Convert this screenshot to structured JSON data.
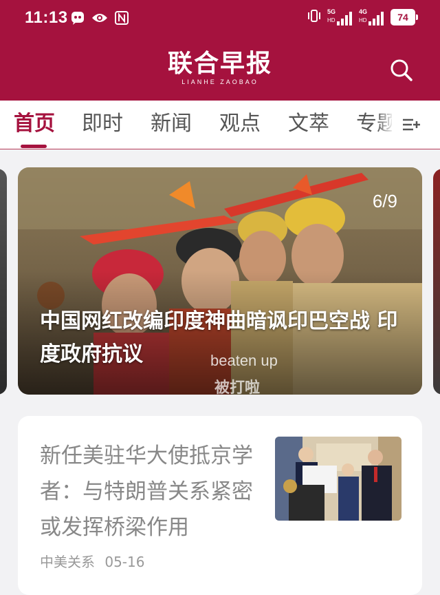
{
  "status_bar": {
    "time": "11:13",
    "network_1": "5G",
    "network_2": "4G",
    "network_sub": "HD",
    "battery": "74"
  },
  "header": {
    "logo_cn": "联合早报",
    "logo_en": "LIANHE ZAOBAO",
    "accent_color": "#a5123e"
  },
  "tabs": [
    "首页",
    "即时",
    "新闻",
    "观点",
    "文萃",
    "专题"
  ],
  "active_tab": "首页",
  "hero": {
    "counter": "6/9",
    "title": "中国网红改编印度神曲暗讽印巴空战 印度政府抗议",
    "subtitle_en": "beaten up",
    "subtitle_cn": "被打啦"
  },
  "article": {
    "title": "新任美驻华大使抵京学者：与特朗普关系紧密或发挥桥梁作用",
    "category": "中美关系",
    "date": "05-16"
  },
  "icons": {
    "search": "search-icon",
    "menu": "tab-menu-icon",
    "photo": "photo-thumbnail"
  }
}
